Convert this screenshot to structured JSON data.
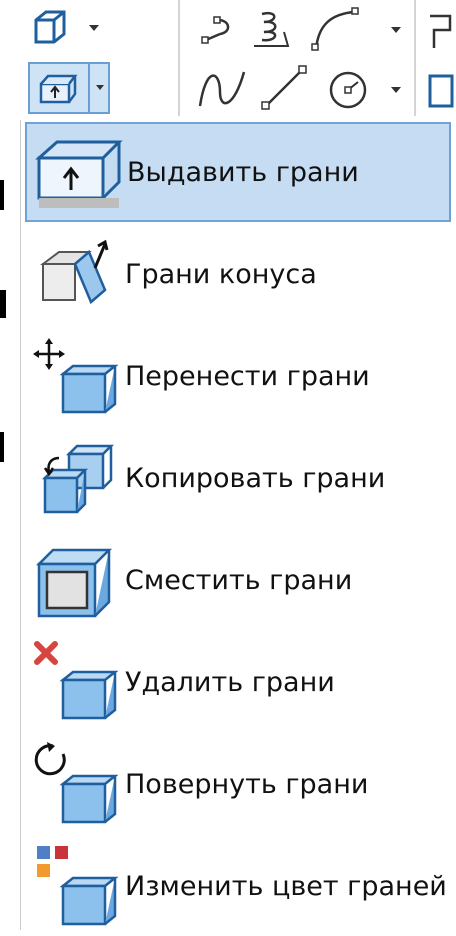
{
  "toolbar": {
    "icons": [
      "box-icon",
      "chevron-down-icon",
      "polyline-icon",
      "helix-icon",
      "arc-icon",
      "chevron-down-icon",
      "spline-icon",
      "line-icon",
      "circle-icon",
      "chevron-down-icon"
    ],
    "active_split": "extrude-faces-icon"
  },
  "menu": {
    "items": [
      {
        "label": "Выдавить грани",
        "icon": "extrude-faces-icon",
        "selected": true
      },
      {
        "label": "Грани конуса",
        "icon": "taper-faces-icon",
        "selected": false
      },
      {
        "label": "Перенести грани",
        "icon": "move-faces-icon",
        "selected": false
      },
      {
        "label": "Копировать грани",
        "icon": "copy-faces-icon",
        "selected": false
      },
      {
        "label": "Сместить грани",
        "icon": "offset-faces-icon",
        "selected": false
      },
      {
        "label": "Удалить грани",
        "icon": "delete-faces-icon",
        "selected": false
      },
      {
        "label": "Повернуть грани",
        "icon": "rotate-faces-icon",
        "selected": false
      },
      {
        "label": "Изменить цвет граней",
        "icon": "color-faces-icon",
        "selected": false
      }
    ]
  },
  "colors": {
    "highlight_fill": "#c6dcf3",
    "highlight_border": "#6fa2d8",
    "cube_face": "#bcdaf4",
    "cube_edge": "#2b6ea8",
    "delete_red": "#d6453f"
  }
}
